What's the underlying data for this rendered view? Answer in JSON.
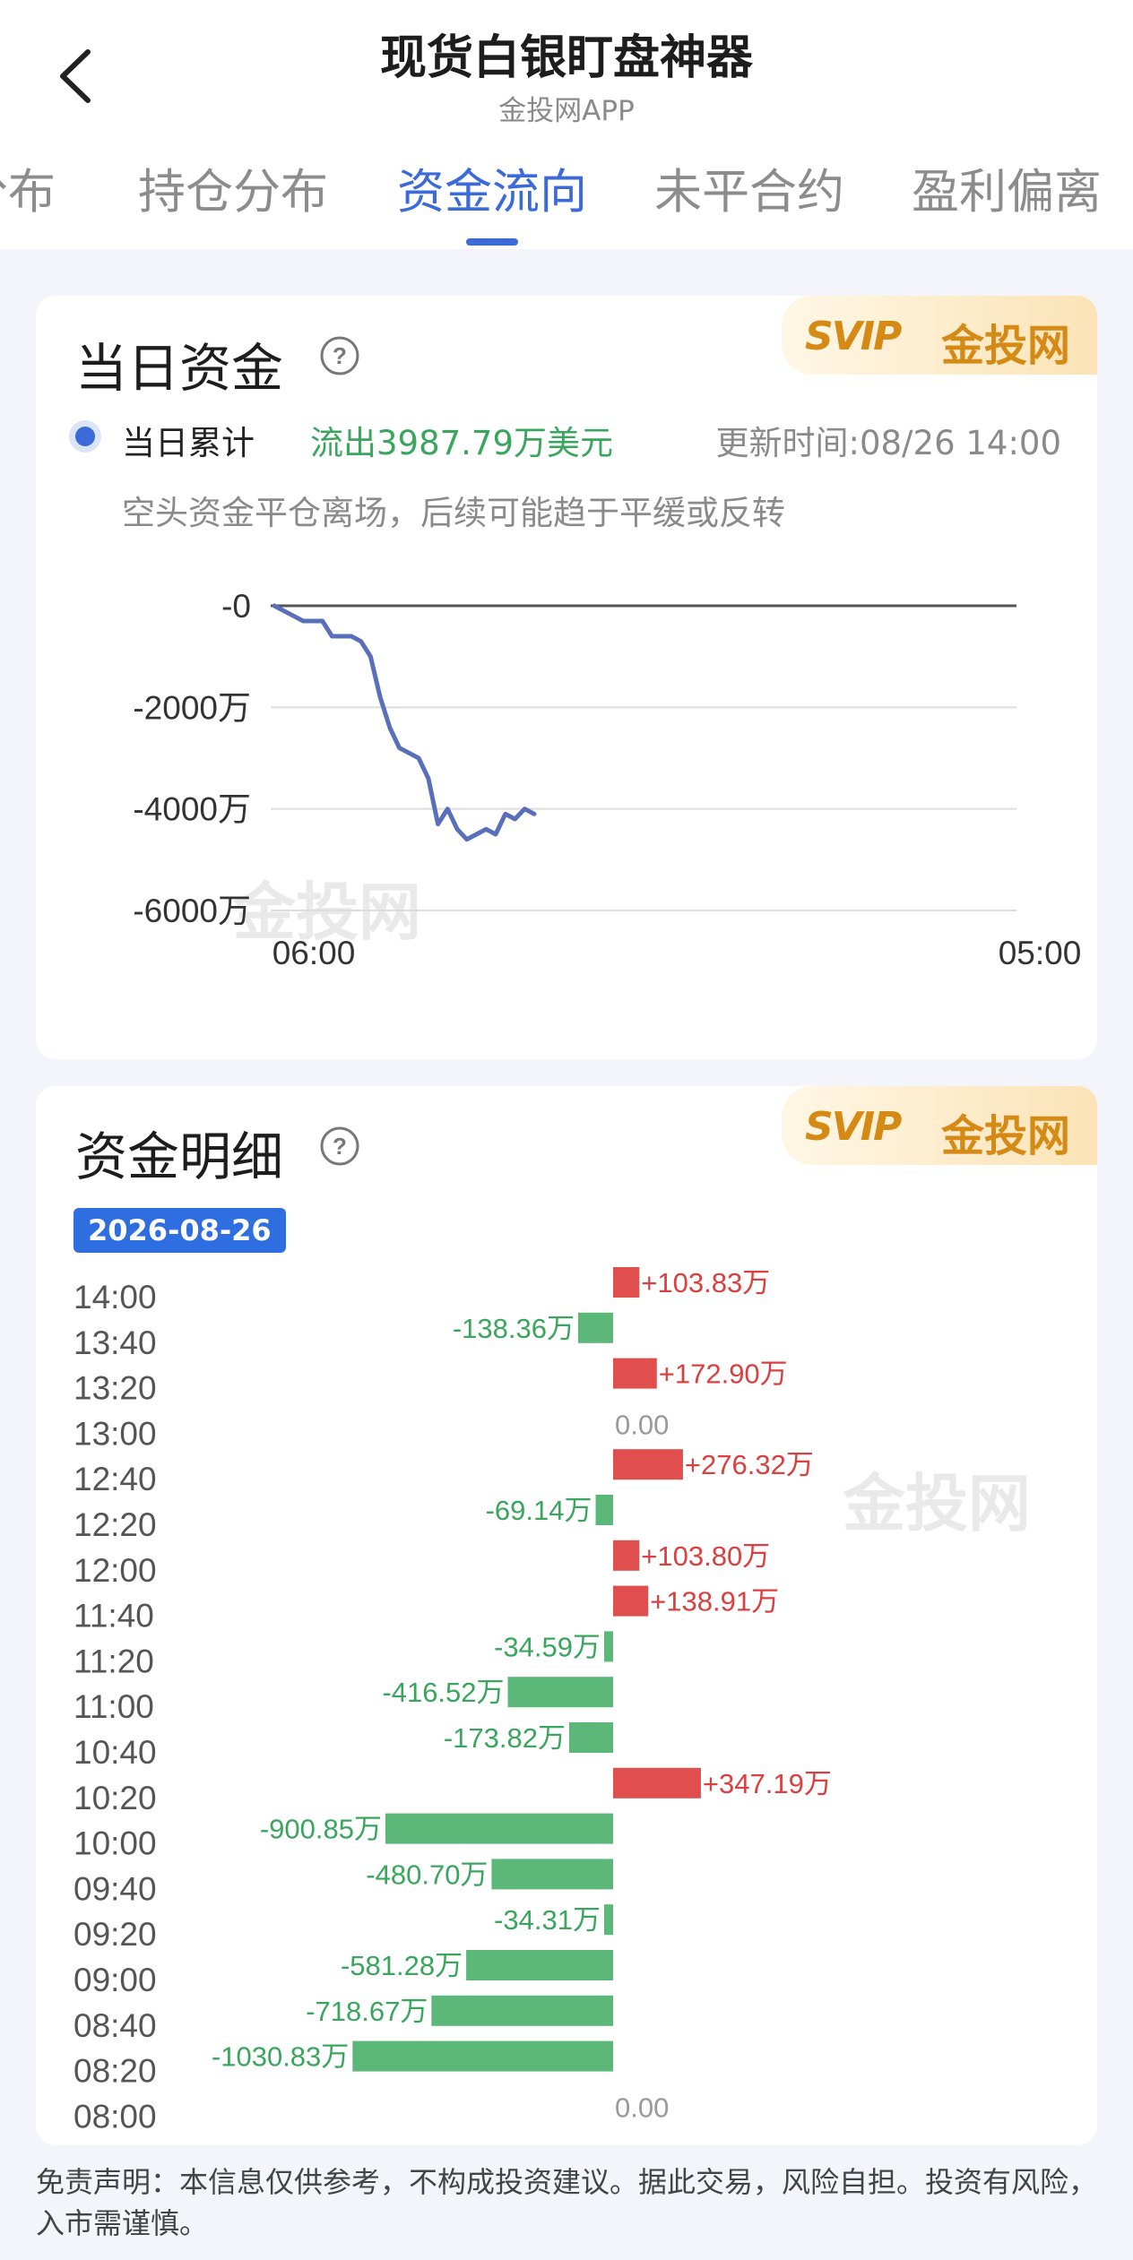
{
  "header": {
    "title": "现货白银盯盘神器",
    "subtitle": "金投网APP"
  },
  "tabs": [
    {
      "label": "分布"
    },
    {
      "label": "持仓分布"
    },
    {
      "label": "资金流向",
      "active": true
    },
    {
      "label": "未平合约"
    },
    {
      "label": "盈利偏离"
    }
  ],
  "daily_fund": {
    "title": "当日资金",
    "legend_label": "当日累计",
    "legend_value": "流出3987.79万美元",
    "update_time": "更新时间:08/26 14:00",
    "comment": "空头资金平仓离场，后续可能趋于平缓或反转"
  },
  "fund_detail": {
    "title": "资金明细",
    "date": "2026-08-26"
  },
  "badge": {
    "logo": "SVIP",
    "brand": "金投网"
  },
  "watermark": "金投网",
  "disclaimer": "免责声明：本信息仅供参考，不构成投资建议。据此交易，风险自担。投资有风险，入市需谨慎。",
  "colors": {
    "accent": "#3c6ad8",
    "inflow": "#e04e4e",
    "outflow": "#5cb878",
    "line": "#5a6fba"
  },
  "chart_data": [
    {
      "type": "line",
      "series": [
        {
          "values": [
            0,
            -100,
            -200,
            -300,
            -300,
            -300,
            -600,
            -600,
            -600,
            -700,
            -1000,
            -1800,
            -2400,
            -2800,
            -2900,
            -3000,
            -3400,
            -4300,
            -4000,
            -4400,
            -4600,
            -4500,
            -4400,
            -4500,
            -4100,
            -4200,
            -4000,
            -4100
          ]
        }
      ],
      "x_tick_labels": [
        "06:00",
        "05:00"
      ],
      "y_tick_labels": [
        "-0",
        "-2000万",
        "-4000万",
        "-6000万"
      ],
      "ylim": [
        -6000,
        0
      ],
      "grid": true
    },
    {
      "type": "bar",
      "orientation": "horizontal",
      "categories": [
        "14:00",
        "13:40",
        "13:20",
        "13:00",
        "12:40",
        "12:20",
        "12:00",
        "11:40",
        "11:20",
        "11:00",
        "10:40",
        "10:20",
        "10:00",
        "09:40",
        "09:20",
        "09:00",
        "08:40",
        "08:20",
        "08:00"
      ],
      "values": [
        103.83,
        -138.36,
        172.9,
        0,
        276.32,
        -69.14,
        103.8,
        138.91,
        -34.59,
        -416.52,
        -173.82,
        347.19,
        -900.85,
        -480.7,
        -34.31,
        -581.28,
        -718.67,
        -1030.83,
        0
      ],
      "labels": [
        "+103.83万",
        "-138.36万",
        "+172.90万",
        "0.00",
        "+276.32万",
        "-69.14万",
        "+103.80万",
        "+138.91万",
        "-34.59万",
        "-416.52万",
        "-173.82万",
        "+347.19万",
        "-900.85万",
        "-480.70万",
        "-34.31万",
        "-581.28万",
        "-718.67万",
        "-1030.83万",
        "0.00"
      ]
    }
  ]
}
